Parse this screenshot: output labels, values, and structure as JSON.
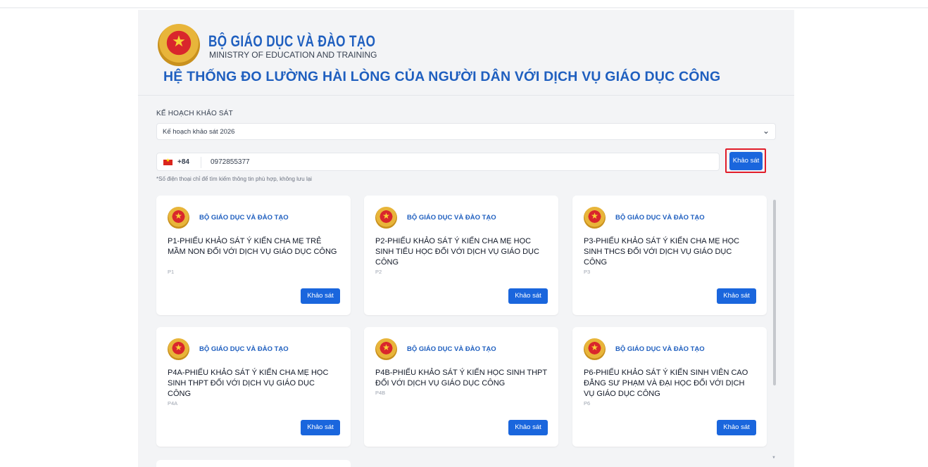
{
  "header": {
    "org_title": "BỘ GIÁO DỤC VÀ ĐÀO TẠO",
    "org_subtitle": "MINISTRY OF EDUCATION AND TRAINING",
    "system_title": "HỆ THỐNG ĐO LƯỜNG HÀI LÒNG CỦA NGƯỜI DÂN VỚI DỊCH VỤ GIÁO DỤC CÔNG"
  },
  "plan": {
    "label": "KẾ HOẠCH KHẢO SÁT",
    "selected": "Kế hoạch khảo sát 2026"
  },
  "phone": {
    "country_code": "+84",
    "value": "0972855377",
    "hint": "*Số điện thoại chỉ để tìm kiếm thông tin phù hợp, không lưu lại"
  },
  "survey_button": "Khảo sát",
  "cards": [
    {
      "org": "BỘ GIÁO DỤC VÀ ĐÀO TẠO",
      "title": "P1-PHIẾU KHẢO SÁT Ý KIẾN CHA MẸ TRẺ MẦM NON ĐỐI VỚI DỊCH VỤ GIÁO DỤC CÔNG",
      "code": "P1",
      "button": "Khảo sát"
    },
    {
      "org": "BỘ GIÁO DỤC VÀ ĐÀO TẠO",
      "title": "P2-PHIẾU KHẢO SÁT Ý KIẾN CHA MẸ HỌC SINH TIỂU HỌC ĐỐI VỚI DỊCH VỤ GIÁO DỤC CÔNG",
      "code": "P2",
      "button": "Khảo sát"
    },
    {
      "org": "BỘ GIÁO DỤC VÀ ĐÀO TẠO",
      "title": "P3-PHIẾU KHẢO SÁT Ý KIẾN CHA MẸ HỌC SINH THCS ĐỐI VỚI DỊCH VỤ GIÁO DỤC CÔNG",
      "code": "P3",
      "button": "Khảo sát"
    },
    {
      "org": "BỘ GIÁO DỤC VÀ ĐÀO TẠO",
      "title": "P4A-PHIẾU KHẢO SÁT Ý KIẾN CHA MẸ HỌC SINH THPT ĐỐI VỚI DỊCH VỤ GIÁO DỤC CÔNG",
      "code": "P4A",
      "button": "Khảo sát"
    },
    {
      "org": "BỘ GIÁO DỤC VÀ ĐÀO TẠO",
      "title": "P4B-PHIẾU KHẢO SÁT Ý KIẾN HỌC SINH THPT ĐỐI VỚI DỊCH VỤ GIÁO DỤC CÔNG",
      "code": "P4B",
      "button": "Khảo sát"
    },
    {
      "org": "BỘ GIÁO DỤC VÀ ĐÀO TẠO",
      "title": "P6-PHIẾU KHẢO SÁT Ý KIẾN SINH VIÊN CAO ĐẲNG SƯ PHẠM VÀ ĐẠI HỌC ĐỐI VỚI DỊCH VỤ GIÁO DỤC CÔNG",
      "code": "P6",
      "button": "Khảo sát"
    }
  ],
  "colors": {
    "brand_blue": "#1f5fbf",
    "button_blue": "#1a66dd",
    "highlight_red": "#e11d2a"
  }
}
